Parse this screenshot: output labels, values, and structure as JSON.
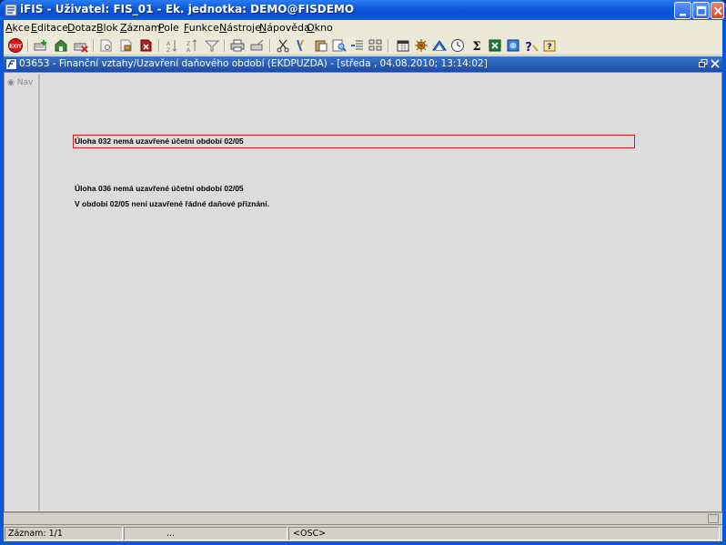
{
  "window": {
    "title": "iFIS - Uživatel: FIS_01 - Ek. jednotka: DEMO@FISDEMO"
  },
  "menu": [
    "Akce",
    "Editace",
    "Dotaz",
    "Blok",
    "Záznam",
    "Pole",
    "Funkce",
    "Nástroje",
    "Nápověda",
    "Okno"
  ],
  "toolbar": {
    "exit_label": "EXIT",
    "icons": [
      "exit-icon",
      "new-record-icon",
      "save-icon",
      "delete-record-icon",
      "print-preview-icon",
      "lock-icon",
      "remove-icon",
      "sort-asc-icon",
      "sort-desc-icon",
      "filter-icon",
      "print-icon",
      "export-icon",
      "cut-icon",
      "copy-icon",
      "paste-icon",
      "find-icon",
      "list-icon",
      "tree-icon",
      "calendar-icon",
      "settings-icon",
      "chart-icon",
      "clock-icon",
      "sum-icon",
      "excel-icon",
      "web-icon",
      "help-icon",
      "help-context-icon"
    ],
    "sum_symbol": "Σ",
    "help_symbol": "?"
  },
  "form": {
    "title": "03653 - Finanční vztahy/Uzavření daňového období (EKDPUZDA) - [středa , 04.08.2010; 13:14:02]",
    "nav_label": "Nav",
    "messages": [
      "Úloha 032 nemá uzavřené  účetní období 02/05",
      "Úloha 036 nemá uzavřené  účetní období 02/05",
      "V období 02/05 není uzavřené řádné daňové přiznání."
    ]
  },
  "status": {
    "record": "Záznam: 1/1",
    "dots": "...",
    "mode": "<OSC>"
  },
  "colors": {
    "title_blue": "#0a58d6",
    "mdi_title": "#1b4ba6",
    "error_border": "#d02020"
  }
}
